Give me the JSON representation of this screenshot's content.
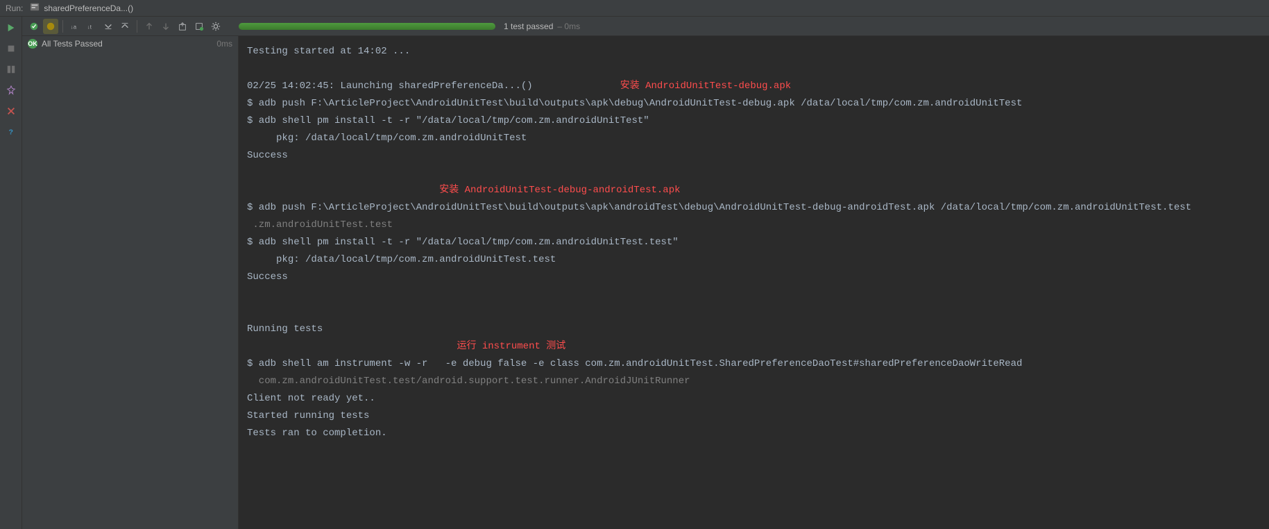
{
  "header": {
    "run_label": "Run:",
    "config_name": "sharedPreferenceDa...()"
  },
  "toolbar": {
    "status_text": "1 test passed",
    "status_time": "– 0ms"
  },
  "tree": {
    "root": {
      "label": "All Tests Passed",
      "time": "0ms"
    }
  },
  "annotations": {
    "a1": "安装 AndroidUnitTest-debug.apk",
    "a2": "安装 AndroidUnitTest-debug-androidTest.apk",
    "a3": "运行 instrument 测试"
  },
  "console_lines": {
    "l1": "Testing started at 14:02 ...",
    "l2": "",
    "l3": "02/25 14:02:45: Launching sharedPreferenceDa...()",
    "l4": "$ adb push F:\\ArticleProject\\AndroidUnitTest\\build\\outputs\\apk\\debug\\AndroidUnitTest-debug.apk /data/local/tmp/com.zm.androidUnitTest",
    "l5": "$ adb shell pm install -t -r \"/data/local/tmp/com.zm.androidUnitTest\"",
    "l6": "     pkg: /data/local/tmp/com.zm.androidUnitTest",
    "l7": "Success",
    "l8": "",
    "l9": "",
    "l10": "$ adb push F:\\ArticleProject\\AndroidUnitTest\\build\\outputs\\apk\\androidTest\\debug\\AndroidUnitTest-debug-androidTest.apk /data/local/tmp/com.zm.androidUnitTest.test",
    "l11_pad": " ",
    "l11": ".zm.androidUnitTest.test",
    "l12": "$ adb shell pm install -t -r \"/data/local/tmp/com.zm.androidUnitTest.test\"",
    "l13": "     pkg: /data/local/tmp/com.zm.androidUnitTest.test",
    "l14": "Success",
    "l15": "",
    "l16": "",
    "l17": "Running tests",
    "l18": "",
    "l19": "$ adb shell am instrument -w -r   -e debug false -e class com.zm.androidUnitTest.SharedPreferenceDaoTest#sharedPreferenceDaoWriteRead",
    "l20_pad": " ",
    "l20": " com.zm.androidUnitTest.test/android.support.test.runner.AndroidJUnitRunner",
    "l21": "Client not ready yet..",
    "l22": "Started running tests",
    "l23": "Tests ran to completion."
  }
}
